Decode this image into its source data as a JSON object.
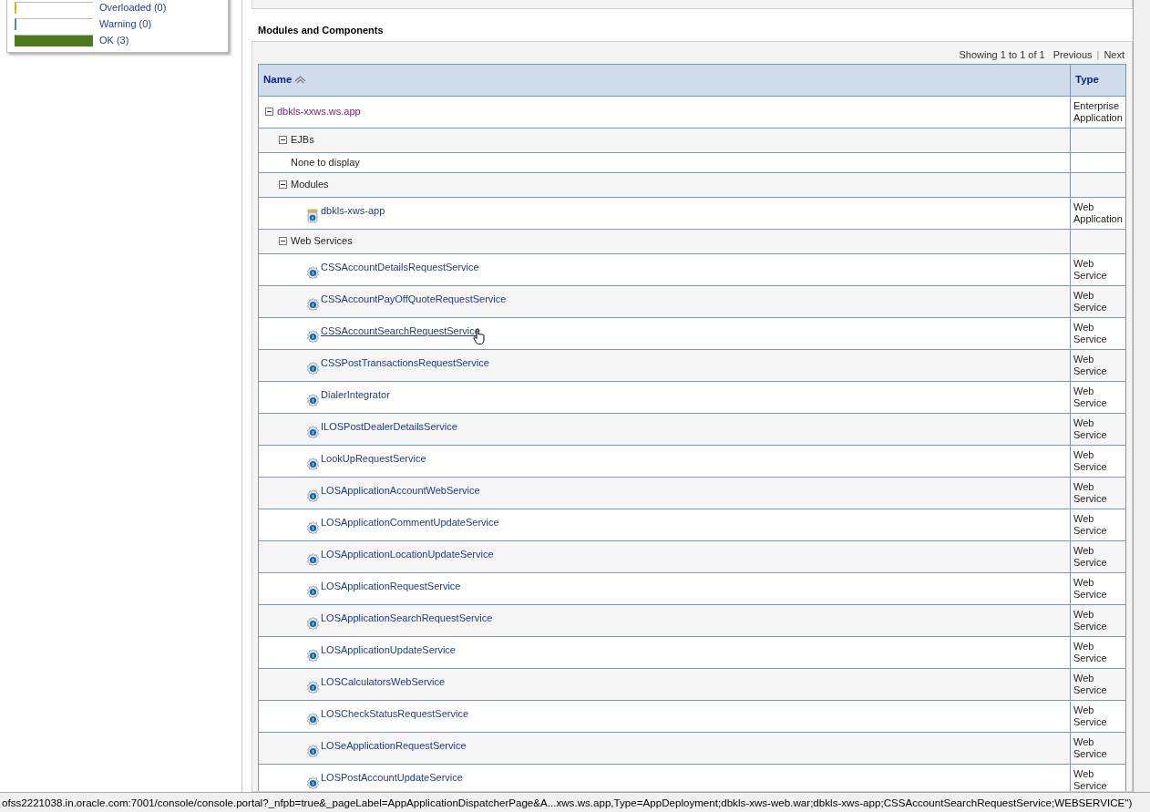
{
  "legend": [
    {
      "label": "Overloaded (0)",
      "color": "#e8b400",
      "level": 0
    },
    {
      "label": "Warning (0)",
      "color": "#4a8fb0",
      "level": 0
    },
    {
      "label": "OK (3)",
      "color": "#4d7a1a",
      "level": 1
    }
  ],
  "section": {
    "title": "Modules and Components",
    "pager": {
      "showing": "Showing 1 to 1 of 1",
      "previous": "Previous",
      "separator": "|",
      "next": "Next"
    },
    "table": {
      "columns": [
        {
          "label": "Name"
        },
        {
          "label": "Type"
        }
      ],
      "rows": [
        {
          "kind": "app",
          "name": "dbkls-xxws.ws.app",
          "type": "Enterprise Application",
          "expanded": true,
          "children": [
            {
              "kind": "group",
              "name": "EJBs",
              "expanded": true,
              "children": [
                {
                  "kind": "empty",
                  "name": "None to display"
                }
              ]
            },
            {
              "kind": "group",
              "name": "Modules",
              "expanded": true,
              "children": [
                {
                  "kind": "module",
                  "name": "dbkls-xws-app",
                  "type": "Web Application"
                }
              ]
            },
            {
              "kind": "group",
              "name": "Web Services",
              "expanded": true,
              "children": [
                {
                  "kind": "service",
                  "name": "CSSAccountDetailsRequestService",
                  "type": "Web Service",
                  "hovered": false
                },
                {
                  "kind": "service",
                  "name": "CSSAccountPayOffQuoteRequestService",
                  "type": "Web Service",
                  "hovered": false
                },
                {
                  "kind": "service",
                  "name": "CSSAccountSearchRequestService",
                  "type": "Web Service",
                  "hovered": true
                },
                {
                  "kind": "service",
                  "name": "CSSPostTransactionsRequestService",
                  "type": "Web Service",
                  "hovered": false
                },
                {
                  "kind": "service",
                  "name": "DialerIntegrator",
                  "type": "Web Service",
                  "hovered": false
                },
                {
                  "kind": "service",
                  "name": "ILOSPostDealerDetailsService",
                  "type": "Web Service",
                  "hovered": false
                },
                {
                  "kind": "service",
                  "name": "LookUpRequestService",
                  "type": "Web Service",
                  "hovered": false
                },
                {
                  "kind": "service",
                  "name": "LOSApplicationAccountWebService",
                  "type": "Web Service",
                  "hovered": false
                },
                {
                  "kind": "service",
                  "name": "LOSApplicationCommentUpdateService",
                  "type": "Web Service",
                  "hovered": false
                },
                {
                  "kind": "service",
                  "name": "LOSApplicationLocationUpdateService",
                  "type": "Web Service",
                  "hovered": false
                },
                {
                  "kind": "service",
                  "name": "LOSApplicationRequestService",
                  "type": "Web Service",
                  "hovered": false
                },
                {
                  "kind": "service",
                  "name": "LOSApplicationSearchRequestService",
                  "type": "Web Service",
                  "hovered": false
                },
                {
                  "kind": "service",
                  "name": "LOSApplicationUpdateService",
                  "type": "Web Service",
                  "hovered": false
                },
                {
                  "kind": "service",
                  "name": "LOSCalculatorsWebService",
                  "type": "Web Service",
                  "hovered": false
                },
                {
                  "kind": "service",
                  "name": "LOSCheckStatusRequestService",
                  "type": "Web Service",
                  "hovered": false
                },
                {
                  "kind": "service",
                  "name": "LOSeApplicationRequestService",
                  "type": "Web Service",
                  "hovered": false
                },
                {
                  "kind": "service",
                  "name": "LOSPostAccountUpdateService",
                  "type": "Web Service",
                  "hovered": false
                }
              ]
            }
          ]
        }
      ]
    }
  },
  "status_bar": {
    "text": "ofss2221038.in.oracle.com:7001/console/console.portal?_nfpb=true&_pageLabel=AppApplicationDispatcherPage&A...xws.ws.app,Type=AppDeployment;dbkls-xws-web.war;dbkls-xws-app;CSSAccountSearchRequestService;WEBSERVICE\")"
  }
}
